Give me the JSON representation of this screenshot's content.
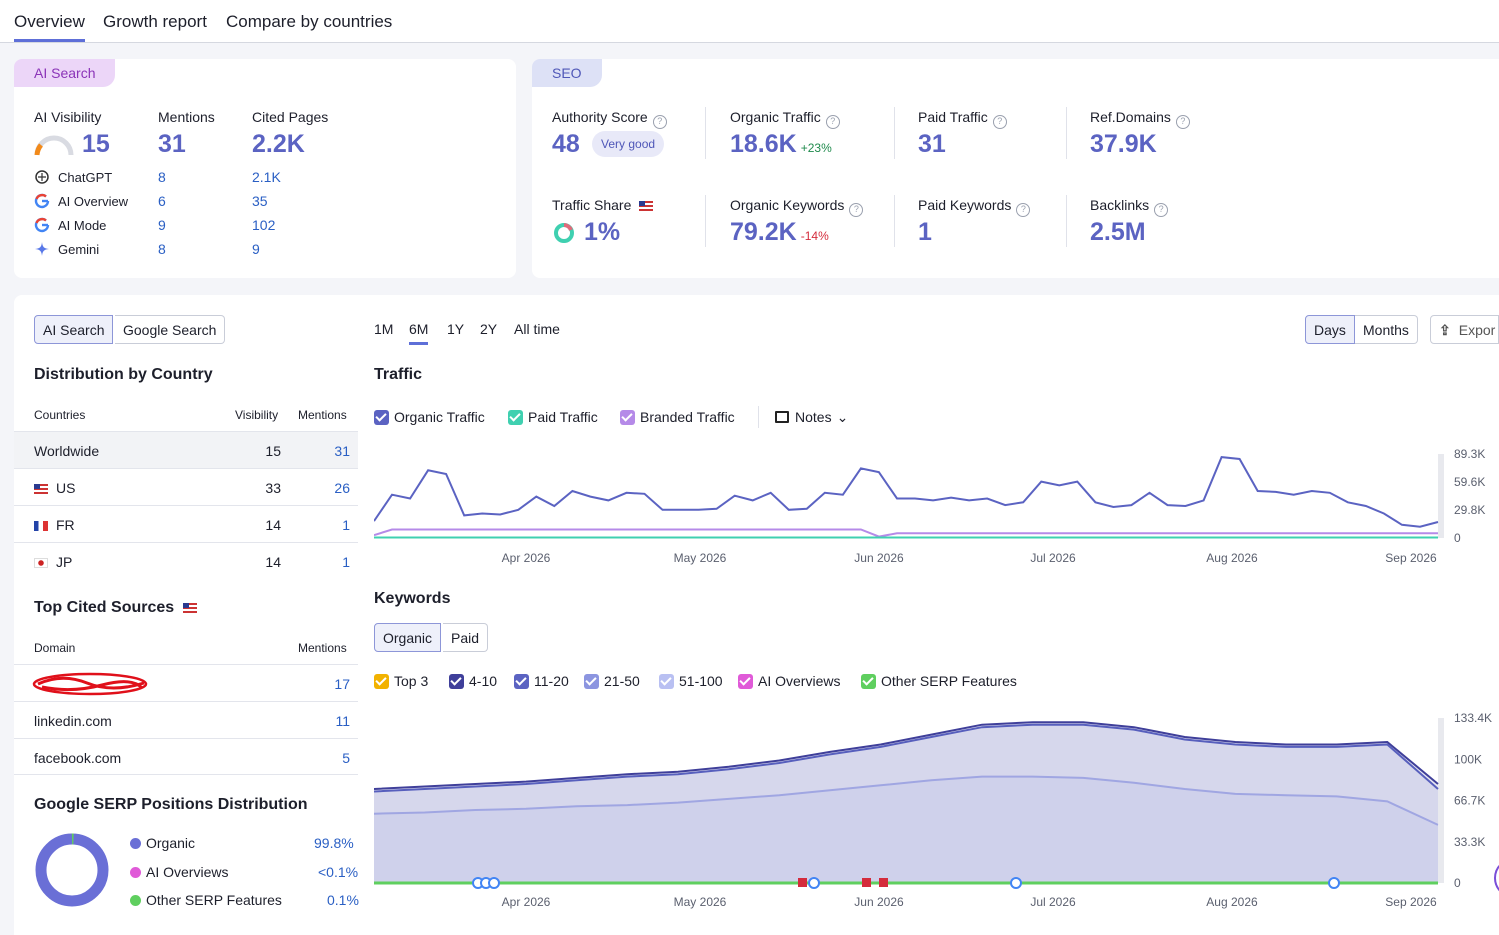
{
  "tabs": [
    "Overview",
    "Growth report",
    "Compare by countries"
  ],
  "ai_search": {
    "pill": "AI Search",
    "visibility_label": "AI Visibility",
    "visibility_value": "15",
    "mentions_label": "Mentions",
    "mentions_value": "31",
    "cited_label": "Cited Pages",
    "cited_value": "2.2K",
    "sources": [
      {
        "name": "ChatGPT",
        "mentions": "8",
        "cited": "2.1K",
        "icon": "chatgpt-icon"
      },
      {
        "name": "AI Overview",
        "mentions": "6",
        "cited": "35",
        "icon": "google-icon"
      },
      {
        "name": "AI Mode",
        "mentions": "9",
        "cited": "102",
        "icon": "google-icon"
      },
      {
        "name": "Gemini",
        "mentions": "8",
        "cited": "9",
        "icon": "gemini-icon"
      }
    ]
  },
  "seo": {
    "pill": "SEO",
    "authority_label": "Authority Score",
    "authority_value": "48",
    "authority_badge": "Very good",
    "organic_traffic_label": "Organic Traffic",
    "organic_traffic_value": "18.6K",
    "organic_traffic_delta": "+23%",
    "paid_traffic_label": "Paid Traffic",
    "paid_traffic_value": "31",
    "ref_domains_label": "Ref.Domains",
    "ref_domains_value": "37.9K",
    "traffic_share_label": "Traffic Share",
    "traffic_share_value": "1%",
    "organic_keywords_label": "Organic Keywords",
    "organic_keywords_value": "79.2K",
    "organic_keywords_delta": "-14%",
    "paid_keywords_label": "Paid Keywords",
    "paid_keywords_value": "1",
    "backlinks_label": "Backlinks",
    "backlinks_value": "2.5M"
  },
  "left_panel": {
    "toggle": [
      "AI Search",
      "Google Search"
    ],
    "distribution_title": "Distribution by Country",
    "dist_headers": [
      "Countries",
      "Visibility",
      "Mentions"
    ],
    "dist_rows": [
      {
        "country": "Worldwide",
        "visibility": "15",
        "mentions": "31"
      },
      {
        "country": "US",
        "visibility": "33",
        "mentions": "26"
      },
      {
        "country": "FR",
        "visibility": "14",
        "mentions": "1"
      },
      {
        "country": "JP",
        "visibility": "14",
        "mentions": "1"
      }
    ],
    "cited_title": "Top Cited Sources",
    "cited_headers": [
      "Domain",
      "Mentions"
    ],
    "cited_rows": [
      {
        "domain": "",
        "mentions": "17"
      },
      {
        "domain": "linkedin.com",
        "mentions": "11"
      },
      {
        "domain": "facebook.com",
        "mentions": "5"
      }
    ],
    "serp_title": "Google SERP Positions Distribution",
    "serp_items": [
      {
        "label": "Organic",
        "value": "99.8%",
        "color": "#6a6fd6"
      },
      {
        "label": "AI Overviews",
        "value": "<0.1%",
        "color": "#e05ad8"
      },
      {
        "label": "Other SERP Features",
        "value": "0.1%",
        "color": "#5fcf5f"
      }
    ]
  },
  "controls": {
    "ranges": [
      "1M",
      "6M",
      "1Y",
      "2Y",
      "All time"
    ],
    "active_range": "6M",
    "granularity": [
      "Days",
      "Months"
    ],
    "export_label": "Expor"
  },
  "traffic": {
    "title": "Traffic",
    "legend": [
      {
        "label": "Organic Traffic",
        "color": "#5b63c2"
      },
      {
        "label": "Paid Traffic",
        "color": "#3fd0b0"
      },
      {
        "label": "Branded Traffic",
        "color": "#b58ae8"
      }
    ],
    "notes_label": "Notes"
  },
  "keywords": {
    "title": "Keywords",
    "toggle": [
      "Organic",
      "Paid"
    ],
    "legend": [
      {
        "label": "Top 3",
        "color": "#f2b200"
      },
      {
        "label": "4-10",
        "color": "#3f3f9a"
      },
      {
        "label": "11-20",
        "color": "#5b63c2"
      },
      {
        "label": "21-50",
        "color": "#8c95e0"
      },
      {
        "label": "51-100",
        "color": "#b9c0f2"
      },
      {
        "label": "AI Overviews",
        "color": "#e05ad8"
      },
      {
        "label": "Other SERP Features",
        "color": "#5fcf5f"
      }
    ]
  },
  "chart_data": [
    {
      "type": "line",
      "title": "Traffic",
      "x_ticks": [
        "Apr 2026",
        "May 2026",
        "Jun 2026",
        "Jul 2026",
        "Aug 2026",
        "Sep 2026"
      ],
      "y_ticks": [
        "89.3K",
        "59.6K",
        "29.8K",
        "0"
      ],
      "ylim": [
        0,
        89300
      ],
      "series": [
        {
          "name": "Organic Traffic",
          "color": "#5b63c2",
          "values": [
            18000,
            46000,
            42000,
            72000,
            68000,
            24000,
            26000,
            25000,
            30000,
            44000,
            34000,
            50000,
            44000,
            40000,
            48000,
            47000,
            30000,
            30000,
            30000,
            31000,
            45000,
            40000,
            48000,
            30000,
            31000,
            48000,
            46000,
            74000,
            70000,
            42000,
            42000,
            40000,
            43000,
            40000,
            42000,
            35000,
            38000,
            60000,
            56000,
            60000,
            38000,
            33000,
            35000,
            48000,
            35000,
            34000,
            40000,
            86000,
            84000,
            50000,
            49000,
            46000,
            50000,
            48000,
            38000,
            34000,
            26000,
            14000,
            12000,
            17000
          ]
        },
        {
          "name": "Paid Traffic",
          "color": "#3fd0b0",
          "values": [
            500,
            500,
            500,
            500,
            500,
            500,
            500,
            500,
            500,
            500,
            500,
            500,
            500,
            500,
            500,
            500,
            500,
            500,
            500,
            500,
            500,
            500,
            500,
            500,
            500,
            500,
            500,
            500,
            500,
            500,
            500,
            500,
            500,
            500,
            500,
            500,
            500,
            500,
            500,
            500,
            500,
            500,
            500,
            500,
            500,
            500,
            500,
            500,
            500,
            500,
            500,
            500,
            500,
            500,
            500,
            500,
            500,
            500,
            500,
            500
          ]
        },
        {
          "name": "Branded Traffic",
          "color": "#b58ae8",
          "values": [
            3000,
            9000,
            9000,
            9000,
            9000,
            9000,
            9000,
            9000,
            9000,
            9000,
            9000,
            9000,
            9000,
            9000,
            9000,
            9000,
            9000,
            9000,
            9000,
            9000,
            9000,
            9000,
            9000,
            9000,
            9000,
            9000,
            9000,
            9000,
            1500,
            5000,
            5000,
            5000,
            5000,
            5000,
            5000,
            5000,
            5000,
            5000,
            5000,
            5000,
            5000,
            5000,
            5000,
            5000,
            5000,
            5000,
            5000,
            5000,
            5000,
            5000,
            5000,
            5000,
            5000,
            5000,
            5000,
            5000,
            5000,
            5000,
            5000,
            5000
          ]
        }
      ]
    },
    {
      "type": "area",
      "title": "Keywords",
      "x_ticks": [
        "Apr 2026",
        "May 2026",
        "Jun 2026",
        "Jul 2026",
        "Aug 2026",
        "Sep 2026"
      ],
      "y_ticks": [
        "133.4K",
        "100K",
        "66.7K",
        "33.3K",
        "0"
      ],
      "ylim": [
        0,
        133400
      ],
      "series": [
        {
          "name": "4-10",
          "color": "#3f3f9a",
          "values": [
            76000,
            78000,
            80000,
            82000,
            85000,
            88000,
            90000,
            94000,
            99000,
            106000,
            112000,
            120000,
            128000,
            130000,
            130000,
            126000,
            118000,
            114000,
            112000,
            112000,
            114000,
            80000
          ]
        },
        {
          "name": "11-20",
          "color": "#5b63c2",
          "values": [
            74000,
            76000,
            78000,
            80000,
            83000,
            86000,
            88000,
            92000,
            97000,
            104000,
            110000,
            118000,
            126000,
            128000,
            128000,
            124000,
            116000,
            112000,
            110000,
            110000,
            112000,
            76000
          ]
        },
        {
          "name": "51-100",
          "color": "#b9c0f2",
          "values": [
            56000,
            57000,
            59000,
            60000,
            62000,
            63000,
            65000,
            68000,
            71000,
            75000,
            79000,
            83000,
            86000,
            86000,
            85000,
            81000,
            76000,
            72000,
            71000,
            70000,
            66000,
            47000
          ]
        }
      ]
    }
  ]
}
